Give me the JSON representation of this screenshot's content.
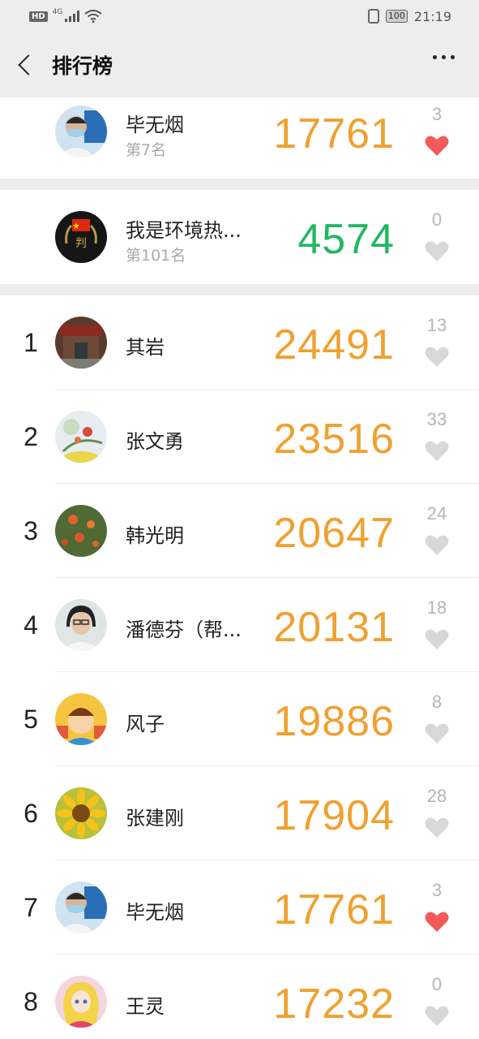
{
  "status_bar": {
    "hd": "HD",
    "network": "4G",
    "battery": "100",
    "time": "21:19"
  },
  "nav": {
    "title": "排行榜",
    "back_icon": "chevron-left-icon",
    "more_icon": "more-dots-icon"
  },
  "colors": {
    "steps_orange": "#f0a030",
    "steps_green": "#22b762",
    "heart_liked": "#f25a5a",
    "heart_unliked": "#d8d8d8"
  },
  "my_card": {
    "name": "毕无烟",
    "rank_text": "第7名",
    "steps": "17761",
    "likes": "3",
    "liked": true
  },
  "team_card": {
    "name": "我是环境热...",
    "rank_text": "第101名",
    "steps": "4574",
    "likes": "0",
    "liked": false
  },
  "ranking": [
    {
      "rank": "1",
      "name": "其岩",
      "steps": "24491",
      "likes": "13",
      "liked": false
    },
    {
      "rank": "2",
      "name": "张文勇",
      "steps": "23516",
      "likes": "33",
      "liked": false
    },
    {
      "rank": "3",
      "name": "韩光明",
      "steps": "20647",
      "likes": "24",
      "liked": false
    },
    {
      "rank": "4",
      "name": "潘德芬（帮...",
      "steps": "20131",
      "likes": "18",
      "liked": false
    },
    {
      "rank": "5",
      "name": "风子",
      "steps": "19886",
      "likes": "8",
      "liked": false
    },
    {
      "rank": "6",
      "name": "张建刚",
      "steps": "17904",
      "likes": "28",
      "liked": false
    },
    {
      "rank": "7",
      "name": "毕无烟",
      "steps": "17761",
      "likes": "3",
      "liked": true
    },
    {
      "rank": "8",
      "name": "王灵",
      "steps": "17232",
      "likes": "0",
      "liked": false
    }
  ]
}
